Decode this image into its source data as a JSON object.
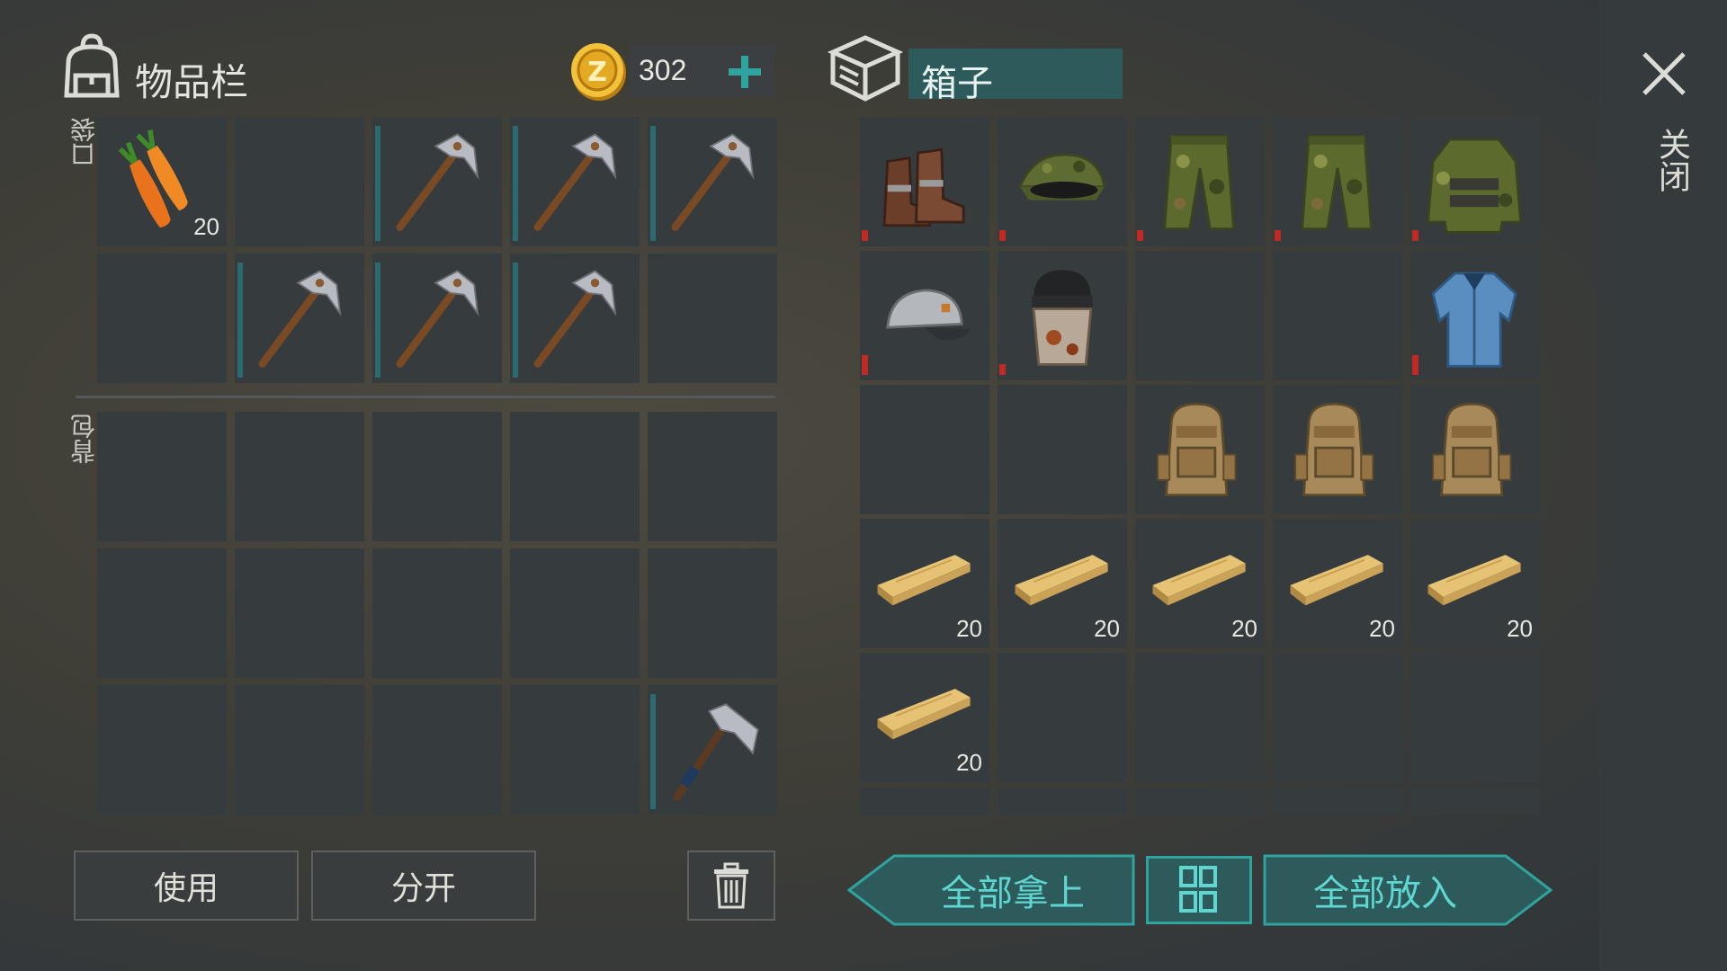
{
  "inventory": {
    "title": "物品栏",
    "pocket_label": "口袋",
    "backpack_label": "背包",
    "coins": "302",
    "pocket_slots": [
      {
        "item": "carrot",
        "count": "20"
      },
      {
        "item": ""
      },
      {
        "item": "pickaxe"
      },
      {
        "item": "pickaxe"
      },
      {
        "item": "pickaxe"
      },
      {
        "item": ""
      },
      {
        "item": "pickaxe"
      },
      {
        "item": "pickaxe"
      },
      {
        "item": "pickaxe"
      },
      {
        "item": ""
      }
    ],
    "backpack_slots": [
      {
        "item": ""
      },
      {
        "item": ""
      },
      {
        "item": ""
      },
      {
        "item": ""
      },
      {
        "item": ""
      },
      {
        "item": ""
      },
      {
        "item": ""
      },
      {
        "item": ""
      },
      {
        "item": ""
      },
      {
        "item": ""
      },
      {
        "item": ""
      },
      {
        "item": ""
      },
      {
        "item": ""
      },
      {
        "item": ""
      },
      {
        "item": "hatchet"
      }
    ],
    "use_label": "使用",
    "split_label": "分开"
  },
  "box": {
    "title": "箱子",
    "slots": [
      {
        "item": "boots"
      },
      {
        "item": "camo-cap-with-goggles"
      },
      {
        "item": "camo-pants"
      },
      {
        "item": "camo-pants"
      },
      {
        "item": "camo-jacket"
      },
      {
        "item": "baseball-cap"
      },
      {
        "item": "welding-mask"
      },
      {
        "item": ""
      },
      {
        "item": ""
      },
      {
        "item": "blue-shirt"
      },
      {
        "item": ""
      },
      {
        "item": ""
      },
      {
        "item": "backpack"
      },
      {
        "item": "backpack"
      },
      {
        "item": "backpack"
      },
      {
        "item": "wood-plank",
        "count": "20"
      },
      {
        "item": "wood-plank",
        "count": "20"
      },
      {
        "item": "wood-plank",
        "count": "20"
      },
      {
        "item": "wood-plank",
        "count": "20"
      },
      {
        "item": "wood-plank",
        "count": "20"
      },
      {
        "item": "wood-plank",
        "count": "20"
      },
      {
        "item": ""
      },
      {
        "item": ""
      },
      {
        "item": ""
      },
      {
        "item": ""
      }
    ],
    "take_all_label": "全部拿上",
    "put_all_label": "全部放入"
  },
  "close_label": "关闭",
  "colors": {
    "teal_accent": "#2fa39e",
    "teal_dark": "#2d5b5c",
    "durability_bar": "#2b6a70",
    "damage_mark": "#c02a22",
    "slot_bg": "#363b3e"
  }
}
